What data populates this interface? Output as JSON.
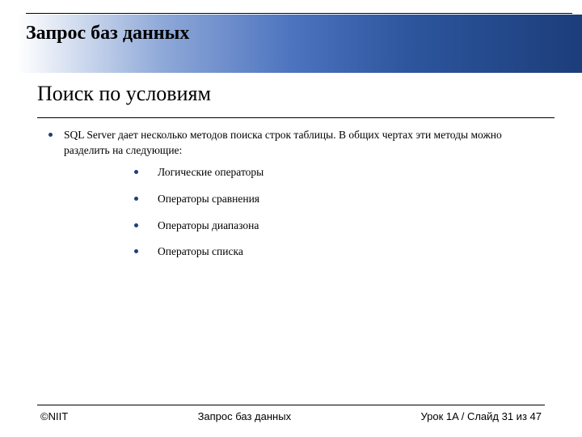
{
  "header": {
    "title": "Запрос баз данных"
  },
  "subtitle": "Поиск по условиям",
  "bullets": {
    "lvl1": "SQL Server дает несколько методов поиска строк таблицы. В общих чертах эти методы можно разделить на следующие:",
    "lvl2": [
      "Логические операторы",
      "Операторы сравнения",
      "Операторы диапазона",
      "Операторы списка"
    ]
  },
  "footer": {
    "left": "©NIIT",
    "center": "Запрос баз данных",
    "right": "Урок 1A / Слайд 31 из 47"
  }
}
